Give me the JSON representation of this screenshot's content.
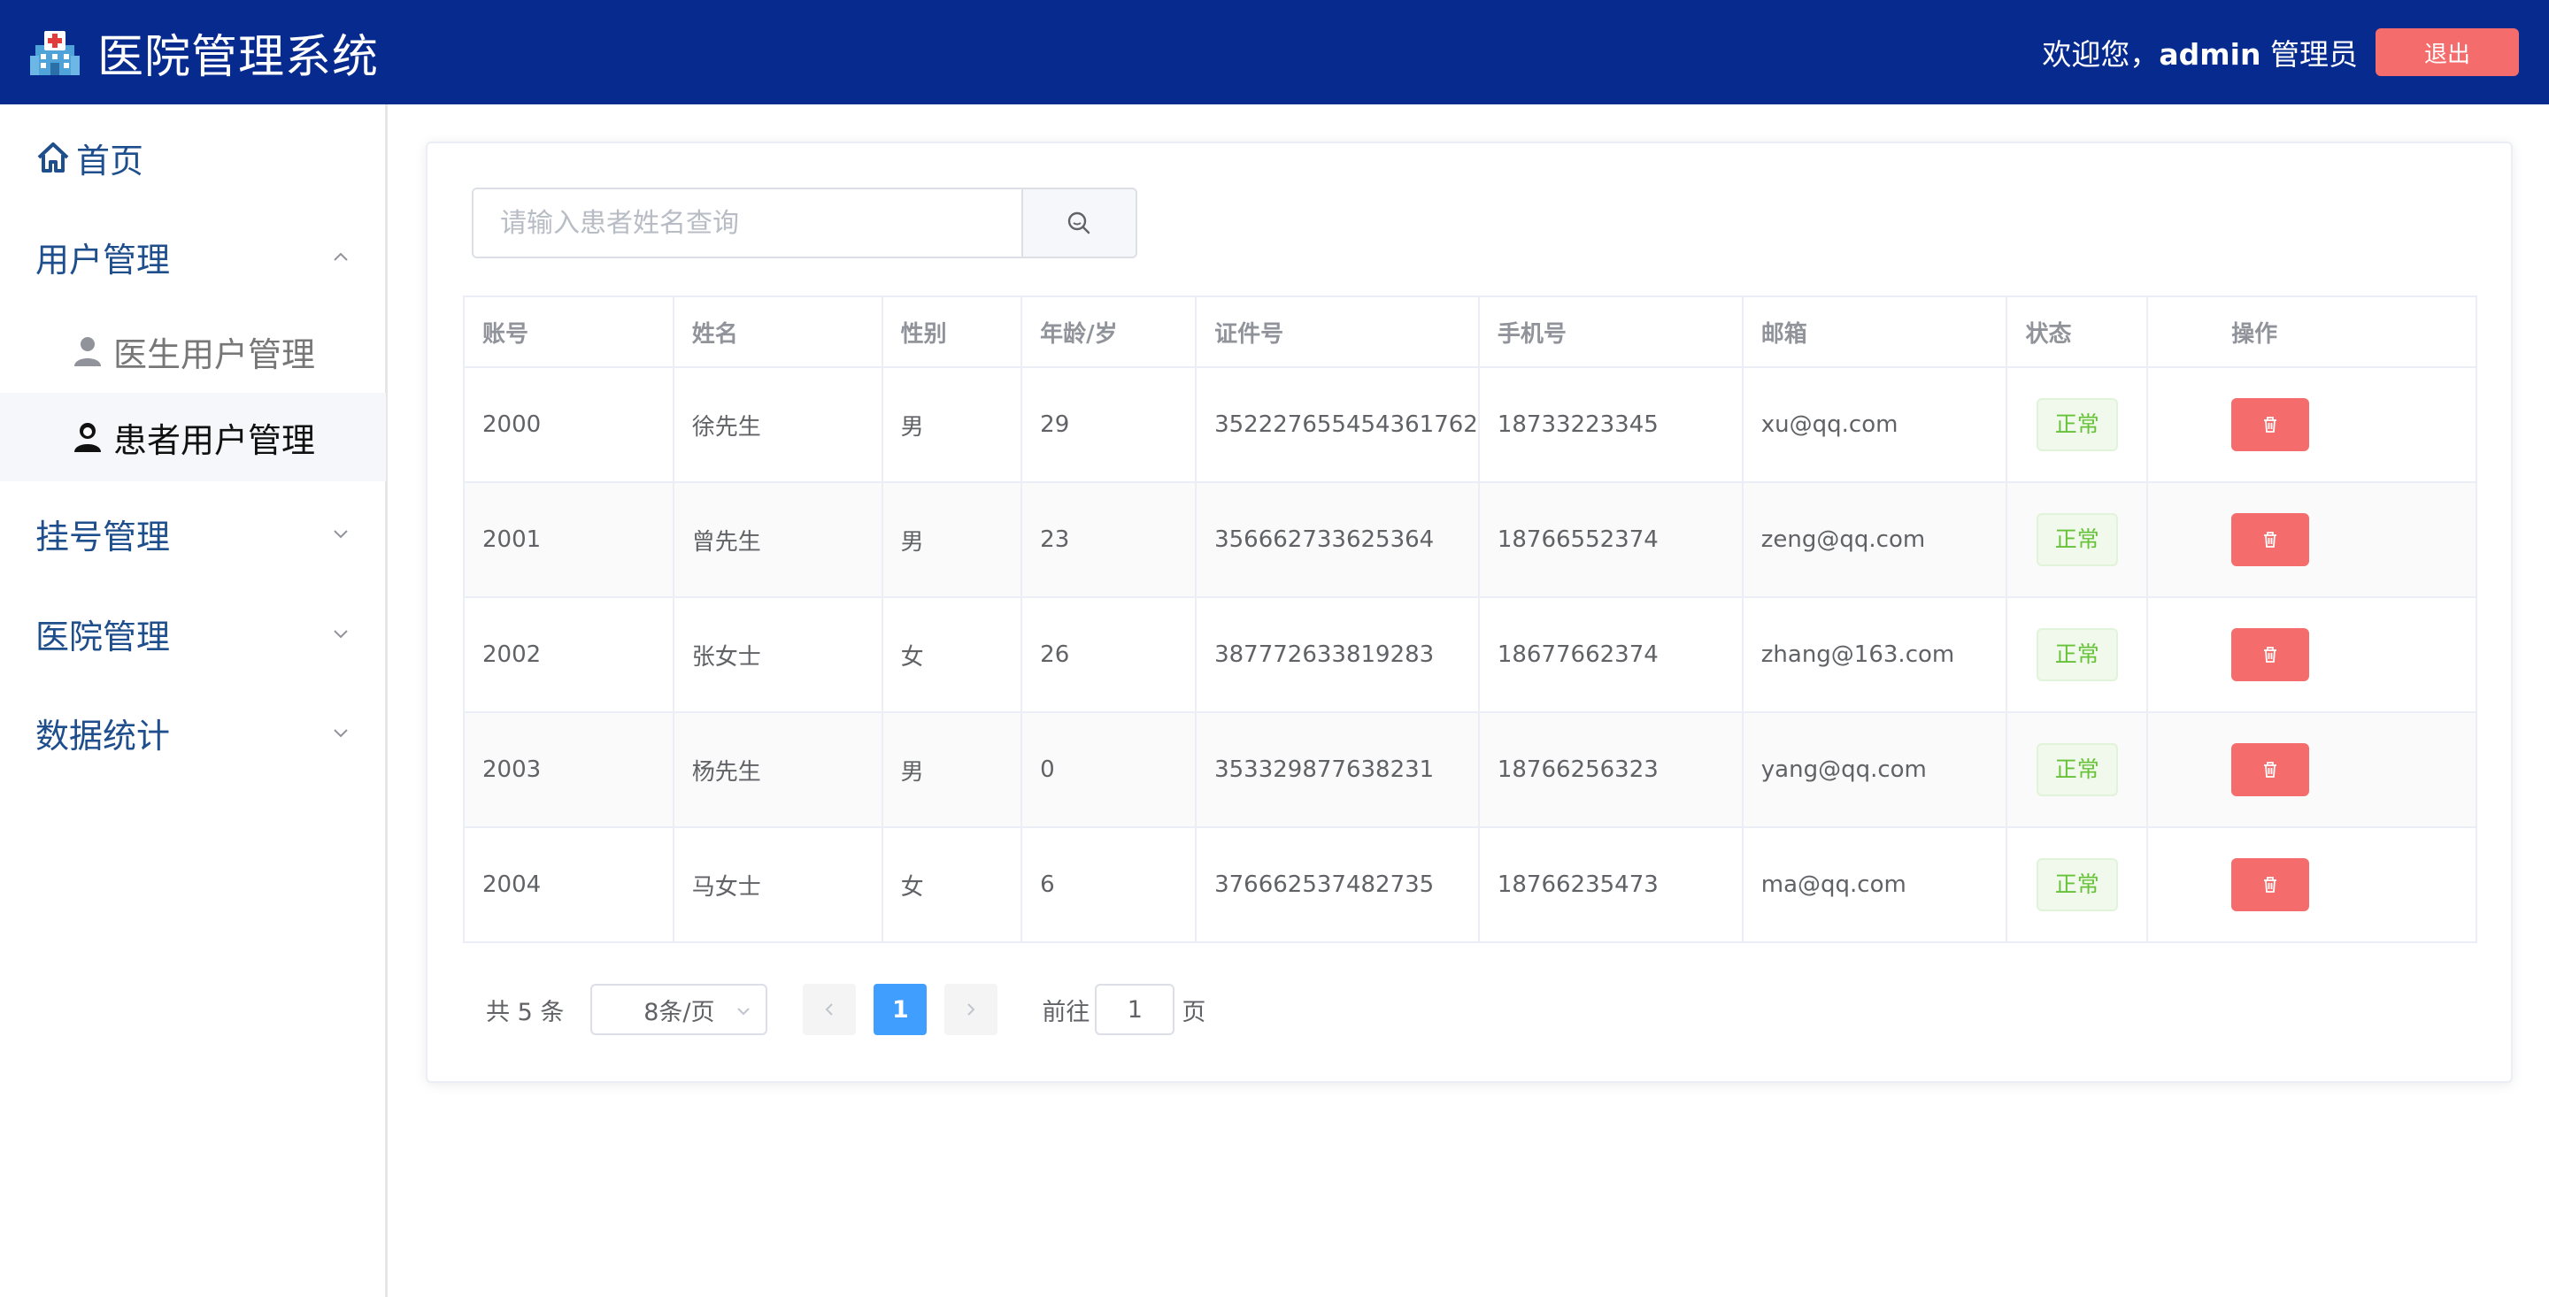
{
  "header": {
    "title": "医院管理系统",
    "welcome": "欢迎您，",
    "user": "admin",
    "role": "管理员",
    "logout_label": "退出",
    "logo_icon": "hospital-icon",
    "colors": {
      "bar": "#072a8e",
      "logout": "#f56c6c"
    }
  },
  "sidebar": {
    "home": {
      "label": "首页",
      "icon": "home-icon"
    },
    "user_mgmt": {
      "label": "用户管理",
      "expanded": true,
      "children": [
        {
          "label": "医生用户管理",
          "icon": "doctor-icon",
          "active": false
        },
        {
          "label": "患者用户管理",
          "icon": "patient-icon",
          "active": true
        }
      ]
    },
    "register_mgmt": {
      "label": "挂号管理",
      "expanded": false
    },
    "hospital_mgmt": {
      "label": "医院管理",
      "expanded": false
    },
    "stats": {
      "label": "数据统计",
      "expanded": false
    }
  },
  "search": {
    "placeholder": "请输入患者姓名查询",
    "value": "",
    "icon": "search-icon"
  },
  "table": {
    "headers": [
      "账号",
      "姓名",
      "性别",
      "年龄/岁",
      "证件号",
      "手机号",
      "邮箱",
      "状态",
      "操作"
    ],
    "rows": [
      {
        "account": "2000",
        "name": "徐先生",
        "gender": "男",
        "age": "29",
        "id_no": "352227655454361762",
        "phone": "18733223345",
        "email": "xu@qq.com",
        "status": "正常"
      },
      {
        "account": "2001",
        "name": "曾先生",
        "gender": "男",
        "age": "23",
        "id_no": "356662733625364",
        "phone": "18766552374",
        "email": "zeng@qq.com",
        "status": "正常"
      },
      {
        "account": "2002",
        "name": "张女士",
        "gender": "女",
        "age": "26",
        "id_no": "387772633819283",
        "phone": "18677662374",
        "email": "zhang@163.com",
        "status": "正常"
      },
      {
        "account": "2003",
        "name": "杨先生",
        "gender": "男",
        "age": "0",
        "id_no": "353329877638231",
        "phone": "18766256323",
        "email": "yang@qq.com",
        "status": "正常"
      },
      {
        "account": "2004",
        "name": "马女士",
        "gender": "女",
        "age": "6",
        "id_no": "376662537482735",
        "phone": "18766235473",
        "email": "ma@qq.com",
        "status": "正常"
      }
    ],
    "delete_icon": "trash-icon",
    "colors": {
      "status_text": "#67c23a",
      "delete": "#f56c6c"
    }
  },
  "pagination": {
    "total_text": "共 5 条",
    "page_size": "8条/页",
    "current_page": "1",
    "goto_label": "前往",
    "goto_value": "1",
    "page_suffix": "页",
    "colors": {
      "active": "#409eff"
    }
  }
}
